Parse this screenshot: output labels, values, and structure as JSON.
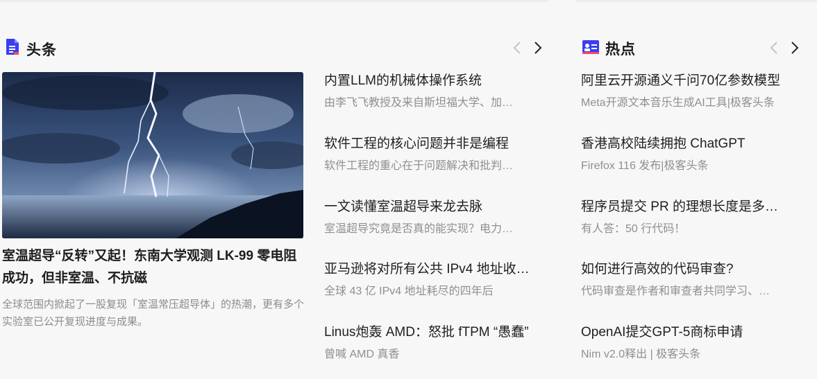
{
  "headlines": {
    "title": "头条",
    "hero": {
      "title": "室温超导“反转”又起！东南大学观测 LK-99 零电阻成功，但非室温、不抗磁",
      "desc": "全球范围内掀起了一股复现「室温常压超导体」的热潮，更有多个实验室已公开复现进度与成果。"
    },
    "items": [
      {
        "title": "内置LLM的机械体操作系统",
        "summary": "由李飞飞教授及来自斯坦福大学、加…"
      },
      {
        "title": "软件工程的核心问题并非是编程",
        "summary": "软件工程的重心在于问题解决和批判…"
      },
      {
        "title": "一文读懂室温超导来龙去脉",
        "summary": "室温超导究竟是否真的能实现？电力…"
      },
      {
        "title": "亚马逊将对所有公共 IPv4 地址收…",
        "summary": "全球 43 亿 IPv4 地址耗尽的四年后"
      },
      {
        "title": "Linus炮轰 AMD：怒批 fTPM “愚蠢”",
        "summary": "曾喊 AMD 真香"
      }
    ]
  },
  "hot": {
    "title": "热点",
    "items": [
      {
        "title": "阿里云开源通义千问70亿参数模型",
        "summary": "Meta开源文本音乐生成AI工具|极客头条"
      },
      {
        "title": "香港高校陆续拥抱 ChatGPT",
        "summary": "Firefox 116 发布|极客头条"
      },
      {
        "title": "程序员提交 PR 的理想长度是多…",
        "summary": "有人答：50 行代码！"
      },
      {
        "title": "如何进行高效的代码审查?",
        "summary": "代码审查是作者和审查者共同学习、…"
      },
      {
        "title": "OpenAI提交GPT-5商标申请",
        "summary": "Nim v2.0释出 | 极客头条"
      }
    ]
  },
  "icons": {
    "headlines": "document-icon",
    "hot": "contact-card-icon",
    "prev": "chevron-left-icon",
    "next": "chevron-right-icon"
  },
  "colors": {
    "accent": "#3b3ef0",
    "accent_red": "#f04a6a"
  }
}
